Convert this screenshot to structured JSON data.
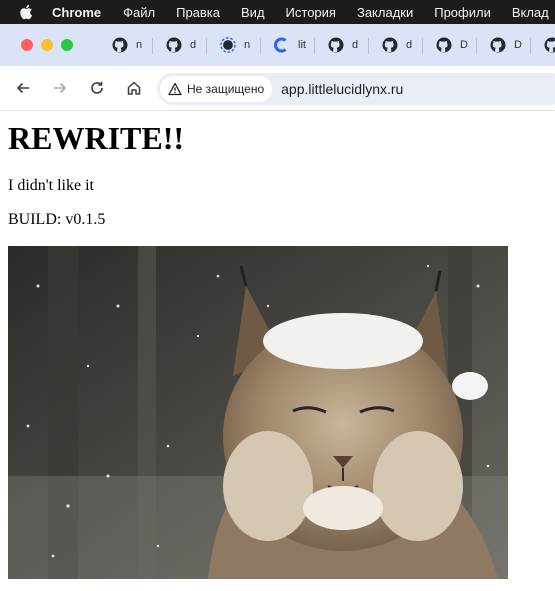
{
  "menubar": {
    "app_name": "Chrome",
    "items": [
      "Файл",
      "Правка",
      "Вид",
      "История",
      "Закладки",
      "Профили",
      "Вклад"
    ]
  },
  "tabs": [
    {
      "icon": "github-icon",
      "title": "n"
    },
    {
      "icon": "github-icon",
      "title": "d"
    },
    {
      "icon": "loading-github-icon",
      "title": "n"
    },
    {
      "icon": "c-logo-icon",
      "title": "lit"
    },
    {
      "icon": "github-icon",
      "title": "d"
    },
    {
      "icon": "github-icon",
      "title": "d"
    },
    {
      "icon": "github-icon",
      "title": "D"
    },
    {
      "icon": "github-icon",
      "title": "D"
    },
    {
      "icon": "github-icon",
      "title": ""
    }
  ],
  "toolbar": {
    "security_label": "Не защищено",
    "url": "app.littlelucidlynx.ru"
  },
  "page": {
    "heading": "REWRITE!!",
    "description": "I didn't like it",
    "build": "BUILD: v0.1.5"
  },
  "colors": {
    "menubar_bg": "#1c1c1e",
    "tabstrip_bg": "#dbe4f7",
    "omnibox_bg": "#e9eef6",
    "close": "#ff5f57",
    "minimize": "#febc2e",
    "zoom": "#28c840"
  }
}
